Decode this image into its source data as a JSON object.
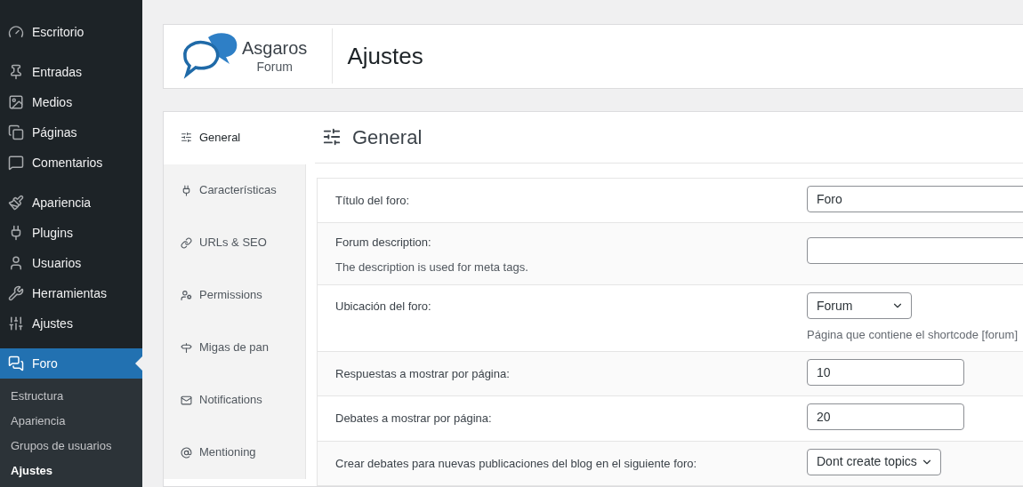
{
  "sidebar": {
    "groups": [
      [
        {
          "label": "Escritorio",
          "selected": false
        }
      ],
      [
        {
          "label": "Entradas",
          "selected": false
        },
        {
          "label": "Medios",
          "selected": false
        },
        {
          "label": "Páginas",
          "selected": false
        },
        {
          "label": "Comentarios",
          "selected": false
        }
      ],
      [
        {
          "label": "Apariencia",
          "selected": false
        },
        {
          "label": "Plugins",
          "selected": false
        },
        {
          "label": "Usuarios",
          "selected": false
        },
        {
          "label": "Herramientas",
          "selected": false
        },
        {
          "label": "Ajustes",
          "selected": false
        }
      ],
      [
        {
          "label": "Foro",
          "selected": true
        }
      ]
    ],
    "submenu": [
      {
        "label": "Estructura",
        "selected": false
      },
      {
        "label": "Apariencia",
        "selected": false
      },
      {
        "label": "Grupos de usuarios",
        "selected": false
      },
      {
        "label": "Ajustes",
        "selected": true
      }
    ]
  },
  "header": {
    "logo_name": "Asgaros",
    "logo_sub": "Forum",
    "title": "Ajustes"
  },
  "tabs": [
    {
      "label": "General",
      "selected": true
    },
    {
      "label": "Características",
      "selected": false
    },
    {
      "label": "URLs & SEO",
      "selected": false
    },
    {
      "label": "Permissions",
      "selected": false
    },
    {
      "label": "Migas de pan",
      "selected": false
    },
    {
      "label": "Notifications",
      "selected": false
    },
    {
      "label": "Mentioning",
      "selected": false
    }
  ],
  "section": {
    "title": "General"
  },
  "rows": [
    {
      "label": "Título del foro:",
      "kind": "text",
      "value": "Foro"
    },
    {
      "label": "Forum description:",
      "description": "The description is used for meta tags.",
      "kind": "text"
    },
    {
      "label": "Ubicación del foro:",
      "kind": "select",
      "value": "Forum",
      "hint": "Página que contiene el shortcode [forum]"
    },
    {
      "label": "Respuestas a mostrar por página:",
      "kind": "number",
      "value": "10"
    },
    {
      "label": "Debates a mostrar por página:",
      "kind": "number",
      "value": "20"
    },
    {
      "label": "Crear debates para nuevas publicaciones del blog en el siguiente foro:",
      "kind": "select",
      "value": "Dont create topics"
    }
  ]
}
